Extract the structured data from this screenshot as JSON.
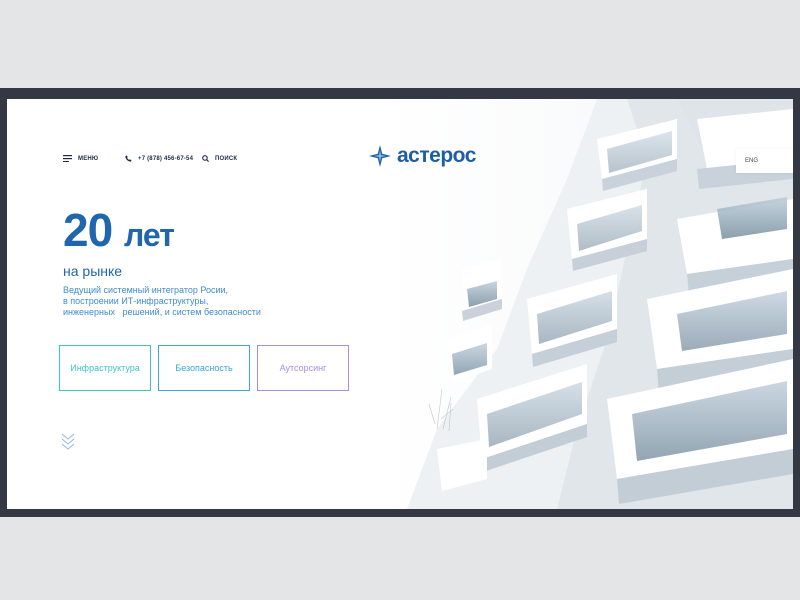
{
  "nav": {
    "menu_label": "МЕНЮ",
    "phone": "+7 (878) 456-67-54",
    "search_label": "ПОИСК"
  },
  "brand": {
    "name": "астерос",
    "color": "#1e5ea6"
  },
  "lang": {
    "label": "ENG"
  },
  "hero": {
    "number": "20",
    "unit": "лет",
    "subtitle": "на рынке",
    "description": [
      "Ведущий системный интегратор Росии,",
      "в построении ИТ-инфраструктуры,",
      "инженерных   решений, и систем безопасности"
    ]
  },
  "buttons": [
    {
      "label": "Инфраструктура",
      "color": "#3fc3c3"
    },
    {
      "label": "Безопасность",
      "color": "#3aa7d6"
    },
    {
      "label": "Аутсорсинг",
      "color": "#a88ee0"
    }
  ],
  "icons": {
    "menu": "hamburger-icon",
    "phone": "phone-icon",
    "search": "search-icon",
    "logo": "star-logo-icon",
    "scroll": "chevron-down-icon"
  },
  "colors": {
    "frame": "#343843",
    "backdrop": "#e3e5e7",
    "accent_blue": "#1f66ad"
  }
}
